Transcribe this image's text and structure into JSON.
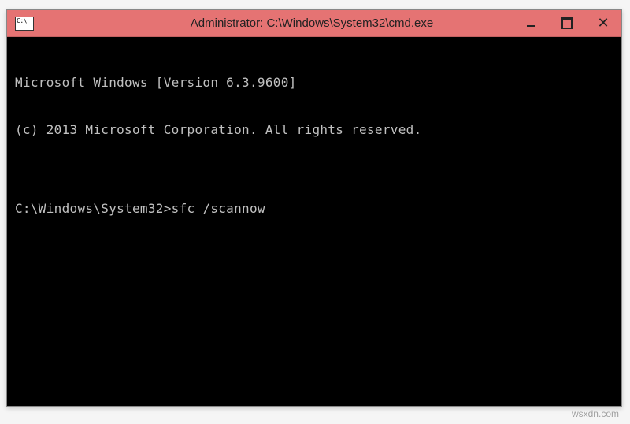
{
  "window": {
    "title": "Administrator: C:\\Windows\\System32\\cmd.exe",
    "icon_name": "cmd-icon"
  },
  "controls": {
    "minimize": "minimize",
    "maximize": "maximize",
    "close": "✕"
  },
  "terminal": {
    "line1": "Microsoft Windows [Version 6.3.9600]",
    "line2": "(c) 2013 Microsoft Corporation. All rights reserved.",
    "blank": "",
    "prompt": "C:\\Windows\\System32>",
    "command": "sfc /scannow"
  },
  "watermark": "wsxdn.com"
}
